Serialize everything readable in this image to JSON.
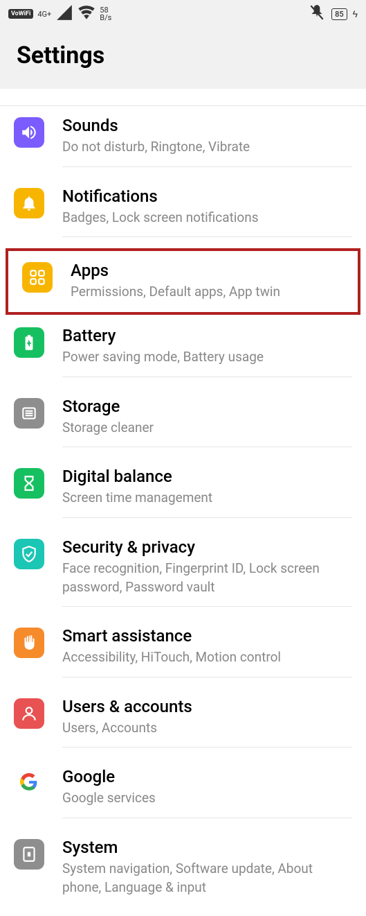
{
  "status": {
    "vowifi": "VoWiFi",
    "network": "4G+",
    "speed_value": "58",
    "speed_unit": "B/s",
    "battery": "85"
  },
  "header": {
    "title": "Settings"
  },
  "items": {
    "sounds": {
      "title": "Sounds",
      "subtitle": "Do not disturb, Ringtone, Vibrate"
    },
    "notifications": {
      "title": "Notifications",
      "subtitle": "Badges, Lock screen notifications"
    },
    "apps": {
      "title": "Apps",
      "subtitle": "Permissions, Default apps, App twin"
    },
    "battery": {
      "title": "Battery",
      "subtitle": "Power saving mode, Battery usage"
    },
    "storage": {
      "title": "Storage",
      "subtitle": "Storage cleaner"
    },
    "digital": {
      "title": "Digital balance",
      "subtitle": "Screen time management"
    },
    "security": {
      "title": "Security & privacy",
      "subtitle": "Face recognition, Fingerprint ID, Lock screen password, Password vault"
    },
    "smart": {
      "title": "Smart assistance",
      "subtitle": "Accessibility, HiTouch, Motion control"
    },
    "users": {
      "title": "Users & accounts",
      "subtitle": "Users, Accounts"
    },
    "google": {
      "title": "Google",
      "subtitle": "Google services"
    },
    "system": {
      "title": "System",
      "subtitle": "System navigation, Software update, About phone, Language & input"
    }
  }
}
